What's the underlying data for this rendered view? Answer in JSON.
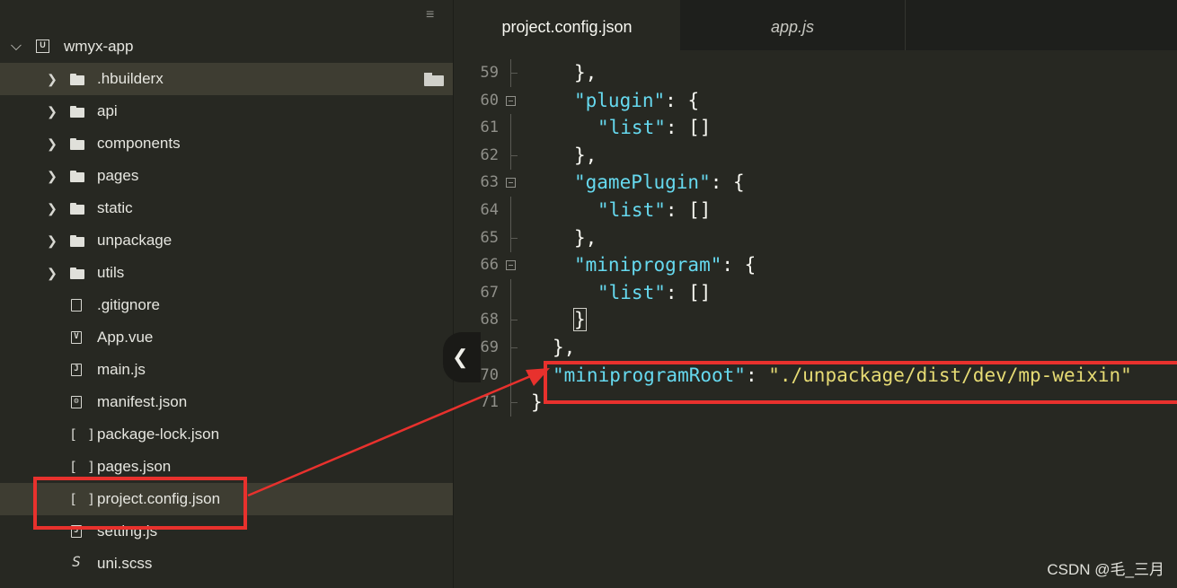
{
  "sidebar": {
    "menu_icon": "≡",
    "root": {
      "label": "wmyx-app",
      "icon": "project-icon"
    },
    "items": [
      {
        "label": ".hbuilderx",
        "type": "folder"
      },
      {
        "label": "api",
        "type": "folder"
      },
      {
        "label": "components",
        "type": "folder"
      },
      {
        "label": "pages",
        "type": "folder"
      },
      {
        "label": "static",
        "type": "folder"
      },
      {
        "label": "unpackage",
        "type": "folder"
      },
      {
        "label": "utils",
        "type": "folder"
      },
      {
        "label": ".gitignore",
        "type": "file",
        "icon": "file-icon"
      },
      {
        "label": "App.vue",
        "type": "file",
        "icon": "vue-file-icon"
      },
      {
        "label": "main.js",
        "type": "file",
        "icon": "js-file-icon"
      },
      {
        "label": "manifest.json",
        "type": "file",
        "icon": "manifest-file-icon"
      },
      {
        "label": "package-lock.json",
        "type": "file",
        "icon": "json-file-icon"
      },
      {
        "label": "pages.json",
        "type": "file",
        "icon": "json-file-icon"
      },
      {
        "label": "project.config.json",
        "type": "file",
        "icon": "json-file-icon"
      },
      {
        "label": "setting.js",
        "type": "file",
        "icon": "js-file-icon"
      },
      {
        "label": "uni.scss",
        "type": "file",
        "icon": "scss-file-icon"
      }
    ]
  },
  "editor": {
    "tabs": [
      {
        "label": "project.config.json",
        "active": true
      },
      {
        "label": "app.js",
        "active": false
      }
    ],
    "lines": [
      {
        "num": "59",
        "text": "},",
        "indent": 1
      },
      {
        "num": "60",
        "key": "\"plugin\"",
        "rest": ": {",
        "indent": 1
      },
      {
        "num": "61",
        "key": "\"list\"",
        "rest": ": []",
        "indent": 2
      },
      {
        "num": "62",
        "text": "},",
        "indent": 1
      },
      {
        "num": "63",
        "key": "\"gamePlugin\"",
        "rest": ": {",
        "indent": 1
      },
      {
        "num": "64",
        "key": "\"list\"",
        "rest": ": []",
        "indent": 2
      },
      {
        "num": "65",
        "text": "},",
        "indent": 1
      },
      {
        "num": "66",
        "key": "\"miniprogram\"",
        "rest": ": {",
        "indent": 1
      },
      {
        "num": "67",
        "key": "\"list\"",
        "rest": ": []",
        "indent": 2
      },
      {
        "num": "68",
        "text": "}",
        "indent": 1
      },
      {
        "num": "69",
        "text": "},",
        "indent": 0
      },
      {
        "num": "70",
        "key": "\"miniprogramRoot\"",
        "rest": ": ",
        "value": "\"./unpackage/dist/dev/mp-weixin\"",
        "indent": 0
      },
      {
        "num": "71",
        "text": "}",
        "indent": -1
      }
    ]
  },
  "collapse_button": "❮",
  "watermark": "CSDN @毛_三月",
  "colors": {
    "background": "#272822",
    "key": "#66d9ef",
    "string": "#e6db74",
    "annotation": "#e8312d"
  }
}
